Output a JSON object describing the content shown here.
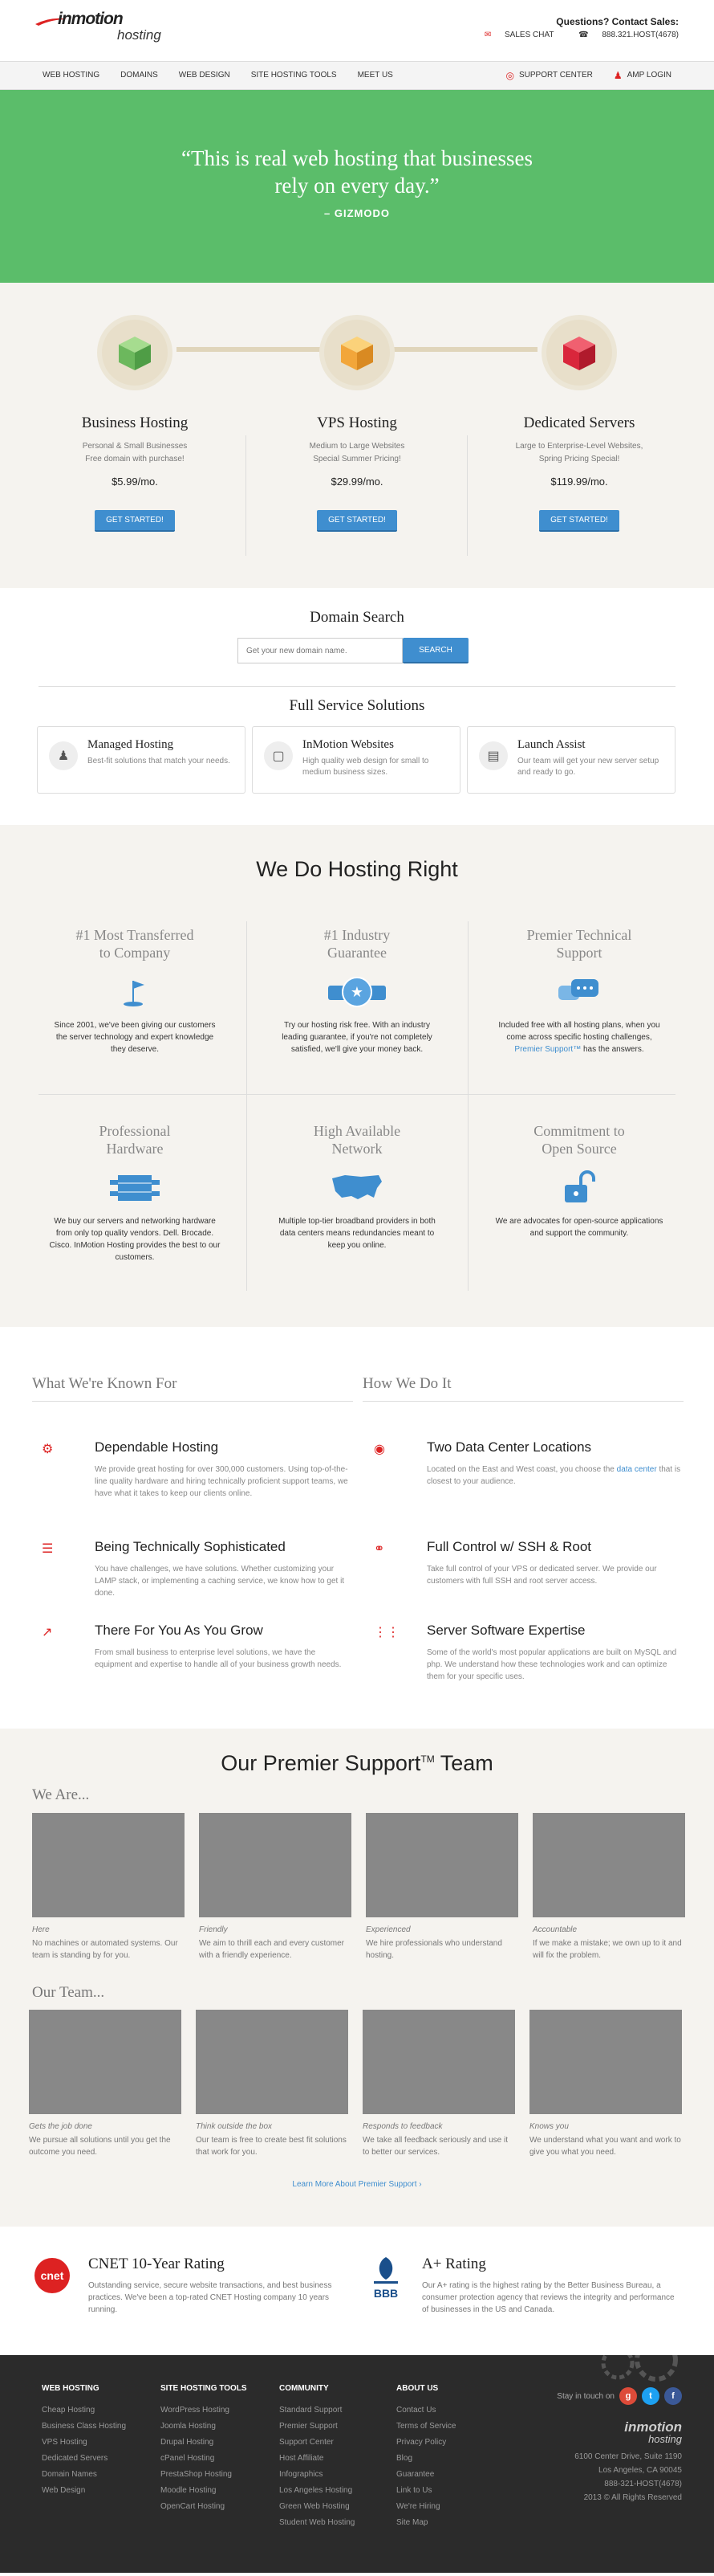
{
  "header": {
    "logo_main": "inmotion",
    "logo_sub": "hosting",
    "contact_title": "Questions? Contact Sales:",
    "sales_chat": "SALES CHAT",
    "phone": "888.321.HOST(4678)"
  },
  "nav": {
    "items": [
      "WEB HOSTING",
      "DOMAINS",
      "WEB DESIGN",
      "SITE HOSTING TOOLS",
      "MEET US"
    ],
    "support_center": "SUPPORT CENTER",
    "amp_login": "AMP LOGIN"
  },
  "hero": {
    "quote_line1": "“This is real web hosting that businesses",
    "quote_line2": "rely on every day.”",
    "source": "– GIZMODO",
    "bg_color": "#5bbd6a"
  },
  "plans": [
    {
      "title": "Business Hosting",
      "sub1": "Personal & Small Businesses",
      "sub2": "Free domain with purchase!",
      "price": "$5.99/mo.",
      "cta": "GET STARTED!",
      "color": "#7fc36f"
    },
    {
      "title": "VPS Hosting",
      "sub1": "Medium to Large Websites",
      "sub2": "Special Summer Pricing!",
      "price": "$29.99/mo.",
      "cta": "GET STARTED!",
      "color": "#f2a63a"
    },
    {
      "title": "Dedicated Servers",
      "sub1": "Large to Enterprise-Level Websites,",
      "sub2": "Spring Pricing Special!",
      "price": "$119.99/mo.",
      "cta": "GET STARTED!",
      "color": "#d9263b"
    }
  ],
  "domain": {
    "title": "Domain Search",
    "placeholder": "Get your new domain name.",
    "button": "SEARCH"
  },
  "solutions": {
    "title": "Full Service Solutions",
    "items": [
      {
        "title": "Managed Hosting",
        "desc": "Best-fit solutions that match your needs."
      },
      {
        "title": "InMotion Websites",
        "desc": "High quality web design for small to medium business sizes."
      },
      {
        "title": "Launch Assist",
        "desc": "Our team will get your new server setup and ready to go."
      }
    ]
  },
  "hosting_right": {
    "title": "We Do Hosting Right",
    "features": [
      {
        "title1": "#1 Most Transferred",
        "title2": "to Company",
        "desc": "Since 2001, we've been giving our customers the server technology and expert knowledge they deserve."
      },
      {
        "title1": "#1 Industry",
        "title2": "Guarantee",
        "desc": "Try our hosting risk free. With an industry leading guarantee, if you're not completely satisfied, we'll give your money back."
      },
      {
        "title1": "Premier Technical",
        "title2": "Support",
        "desc_a": "Included free with all hosting plans, when you come across specific hosting challenges, ",
        "desc_link": "Premier Support™",
        "desc_b": " has the answers."
      },
      {
        "title1": "Professional",
        "title2": "Hardware",
        "desc": "We buy our servers and networking hardware from only top quality vendors. Dell. Brocade. Cisco. InMotion Hosting provides the best to our customers."
      },
      {
        "title1": "High Available",
        "title2": "Network",
        "desc": "Multiple top-tier broadband providers in both data centers means redundancies meant to keep you online."
      },
      {
        "title1": "Commitment to",
        "title2": "Open Source",
        "desc": "We are advocates for open-source applications and support the community."
      }
    ]
  },
  "known": {
    "left_title": "What We're Known For",
    "right_title": "How We Do It",
    "left": [
      {
        "title": "Dependable Hosting",
        "desc": "We provide great hosting for over 300,000 customers. Using top-of-the-line quality hardware and hiring technically proficient support teams, we have what it takes to keep our clients online."
      },
      {
        "title": "Being Technically Sophisticated",
        "desc": "You have challenges, we have solutions. Whether customizing your LAMP stack, or implementing a caching service, we know how to get it done."
      },
      {
        "title": "There For You As You Grow",
        "desc": "From small business to enterprise level solutions, we have the equipment and expertise to handle all of your business growth needs."
      }
    ],
    "right": [
      {
        "title": "Two Data Center Locations",
        "desc_a": "Located on the East and West coast, you choose the ",
        "desc_link": "data center",
        "desc_b": " that is closest to your audience."
      },
      {
        "title": "Full Control w/ SSH & Root",
        "desc": "Take full control of your VPS or dedicated server. We provide our customers with full SSH and root server access."
      },
      {
        "title": "Server Software Expertise",
        "desc": "Some of the world's most popular applications are built on MySQL and php. We understand how these technologies work and can optimize them for your specific uses."
      }
    ]
  },
  "support": {
    "title": "Our Premier Support",
    "tm": "TM",
    "title_end": " Team",
    "we_are": "We Are...",
    "we_are_cards": [
      {
        "cap": "Here",
        "desc": "No machines or automated systems. Our team is standing by for you."
      },
      {
        "cap": "Friendly",
        "desc": "We aim to thrill each and every customer with a friendly experience."
      },
      {
        "cap": "Experienced",
        "desc": "We hire professionals who understand hosting."
      },
      {
        "cap": "Accountable",
        "desc": "If we make a mistake; we own up to it and will fix the problem."
      }
    ],
    "our_team": "Our Team...",
    "team_cards": [
      {
        "cap": "Gets the job done",
        "desc": "We pursue all solutions until you get the outcome you need."
      },
      {
        "cap": "Think outside the box",
        "desc": "Our team is free to create best fit solutions that work for you."
      },
      {
        "cap": "Responds to feedback",
        "desc": "We take all feedback seriously and use it to better our services."
      },
      {
        "cap": "Knows you",
        "desc": "We understand what you want and work to give you what you need."
      }
    ],
    "learn_more": "Learn More About Premier Support ›"
  },
  "ratings": [
    {
      "logo": "cnet",
      "title": "CNET 10-Year Rating",
      "desc": "Outstanding service, secure website transactions, and best business practices. We've been a top-rated CNET Hosting company 10 years running."
    },
    {
      "logo": "BBB",
      "title": "A+ Rating",
      "desc": "Our A+ rating is the highest rating by the Better Business Bureau, a consumer protection agency that reviews the integrity and performance of businesses in the US and Canada."
    }
  ],
  "footer": {
    "cols": [
      {
        "title": "WEB HOSTING",
        "items": [
          "Cheap Hosting",
          "Business Class Hosting",
          "VPS Hosting",
          "Dedicated Servers",
          "Domain Names",
          "Web Design"
        ]
      },
      {
        "title": "SITE HOSTING TOOLS",
        "items": [
          "WordPress Hosting",
          "Joomla Hosting",
          "Drupal Hosting",
          "cPanel Hosting",
          "PrestaShop Hosting",
          "Moodle Hosting",
          "OpenCart Hosting"
        ]
      },
      {
        "title": "COMMUNITY",
        "items": [
          "Standard Support",
          "Premier Support",
          "Support Center",
          "Host Affiliate",
          "Infographics",
          "Los Angeles Hosting",
          "Green Web Hosting",
          "Student Web Hosting"
        ]
      },
      {
        "title": "ABOUT US",
        "items": [
          "Contact Us",
          "Terms of Service",
          "Privacy Policy",
          "Blog",
          "Guarantee",
          "Link to Us",
          "We're Hiring",
          "Site Map"
        ]
      }
    ],
    "stay": "Stay in touch on",
    "logo_main": "inmotion",
    "logo_sub": "hosting",
    "addr1": "6100 Center Drive, Suite 1190",
    "addr2": "Los Angeles, CA 90045",
    "addr3": "888-321-HOST(4678)",
    "addr4": "2013 © All Rights Reserved"
  }
}
